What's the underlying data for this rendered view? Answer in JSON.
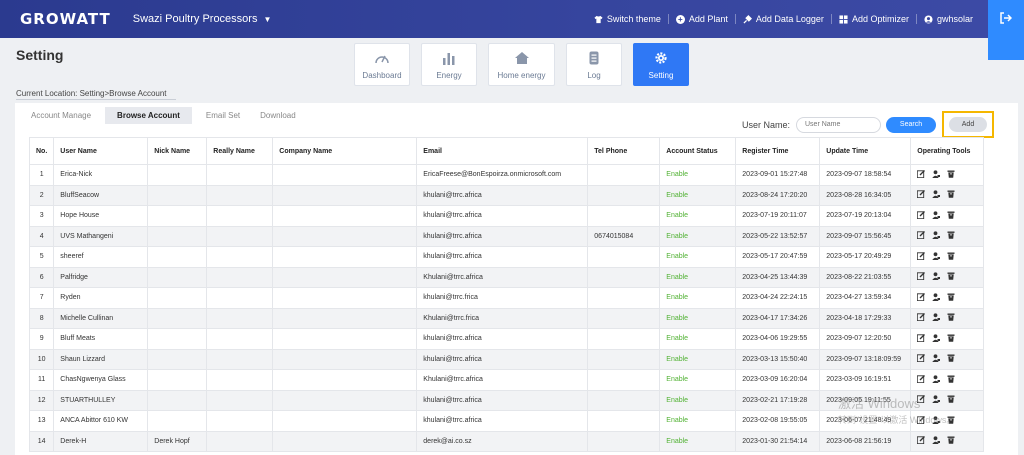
{
  "topbar": {
    "logo": "GROWATT",
    "plant": "Swazi Poultry Processors",
    "actions": {
      "switch_theme": "Switch theme",
      "add_plant": "Add Plant",
      "add_logger": "Add Data Logger",
      "add_optimizer": "Add Optimizer",
      "user": "gwhsolar"
    }
  },
  "page": {
    "title": "Setting",
    "location": "Current Location: Setting>Browse Account"
  },
  "tiles": {
    "dashboard": "Dashboard",
    "energy": "Energy",
    "home_energy": "Home energy",
    "log": "Log",
    "setting": "Setting"
  },
  "subtabs": {
    "account_manage": "Account Manage",
    "browse_account": "Browse Account",
    "email_set": "Email Set",
    "download": "Download"
  },
  "search": {
    "label": "User Name:",
    "placeholder": "User Name",
    "search_btn": "Search",
    "add_btn": "Add"
  },
  "table": {
    "headers": [
      "No.",
      "User Name",
      "Nick Name",
      "Really Name",
      "Company Name",
      "Email",
      "Tel Phone",
      "Account Status",
      "Register Time",
      "Update Time",
      "Operating Tools"
    ],
    "rows": [
      [
        "1",
        "Erica-Nick",
        "",
        "",
        "",
        "EricaFreese@BonEspoirza.onmicrosoft.com",
        "",
        "Enable",
        "2023-09-01 15:27:48",
        "2023-09-07 18:58:54"
      ],
      [
        "2",
        "BluffSeacow",
        "",
        "",
        "",
        "khulani@trrc.africa",
        "",
        "Enable",
        "2023-08-24 17:20:20",
        "2023-08-28 16:34:05"
      ],
      [
        "3",
        "Hope House",
        "",
        "",
        "",
        "khulani@trrc.africa",
        "",
        "Enable",
        "2023-07-19 20:11:07",
        "2023-07-19 20:13:04"
      ],
      [
        "4",
        "UVS Mathangeni",
        "",
        "",
        "",
        "khulani@trrc.africa",
        "0674015084",
        "Enable",
        "2023-05-22 13:52:57",
        "2023-09-07 15:56:45"
      ],
      [
        "5",
        "sheeref",
        "",
        "",
        "",
        "khulani@trrc.africa",
        "",
        "Enable",
        "2023-05-17 20:47:59",
        "2023-05-17 20:49:29"
      ],
      [
        "6",
        "Palfridge",
        "",
        "",
        "",
        "Khulani@trrc.africa",
        "",
        "Enable",
        "2023-04-25 13:44:39",
        "2023-08-22 21:03:55"
      ],
      [
        "7",
        "Ryden",
        "",
        "",
        "",
        "khulani@trrc.frica",
        "",
        "Enable",
        "2023-04-24 22:24:15",
        "2023-04-27 13:59:34"
      ],
      [
        "8",
        "Michelle Cullinan",
        "",
        "",
        "",
        "Khulani@trrc.frica",
        "",
        "Enable",
        "2023-04-17 17:34:26",
        "2023-04-18 17:29:33"
      ],
      [
        "9",
        "Bluff Meats",
        "",
        "",
        "",
        "khulani@trrc.africa",
        "",
        "Enable",
        "2023-04-06 19:29:55",
        "2023-09-07 12:20:50"
      ],
      [
        "10",
        "Shaun Lizzard",
        "",
        "",
        "",
        "khulani@trrc.africa",
        "",
        "Enable",
        "2023-03-13 15:50:40",
        "2023-09-07 13:18:09:59"
      ],
      [
        "11",
        "ChasNgwenya Glass",
        "",
        "",
        "",
        "Khulani@trrc.africa",
        "",
        "Enable",
        "2023-03-09 16:20:04",
        "2023-03-09 16:19:51"
      ],
      [
        "12",
        "STUARTHULLEY",
        "",
        "",
        "",
        "khulani@trrc.africa",
        "",
        "Enable",
        "2023-02-21 17:19:28",
        "2023-09-05 19:11:55"
      ],
      [
        "13",
        "ANCA Abittor 610 KW",
        "",
        "",
        "",
        "khulani@trrc.africa",
        "",
        "Enable",
        "2023-02-08 19:55:05",
        "2023-06-07 21:48:49"
      ],
      [
        "14",
        "Derek-H",
        "Derek Hopf",
        "",
        "",
        "derek@ai.co.sz",
        "",
        "Enable",
        "2023-01-30 21:54:14",
        "2023-06-08 21:56:19"
      ]
    ]
  },
  "watermark": {
    "line1": "激活 Windows",
    "line2": "转到\"设置\"以激活 Windows。"
  }
}
